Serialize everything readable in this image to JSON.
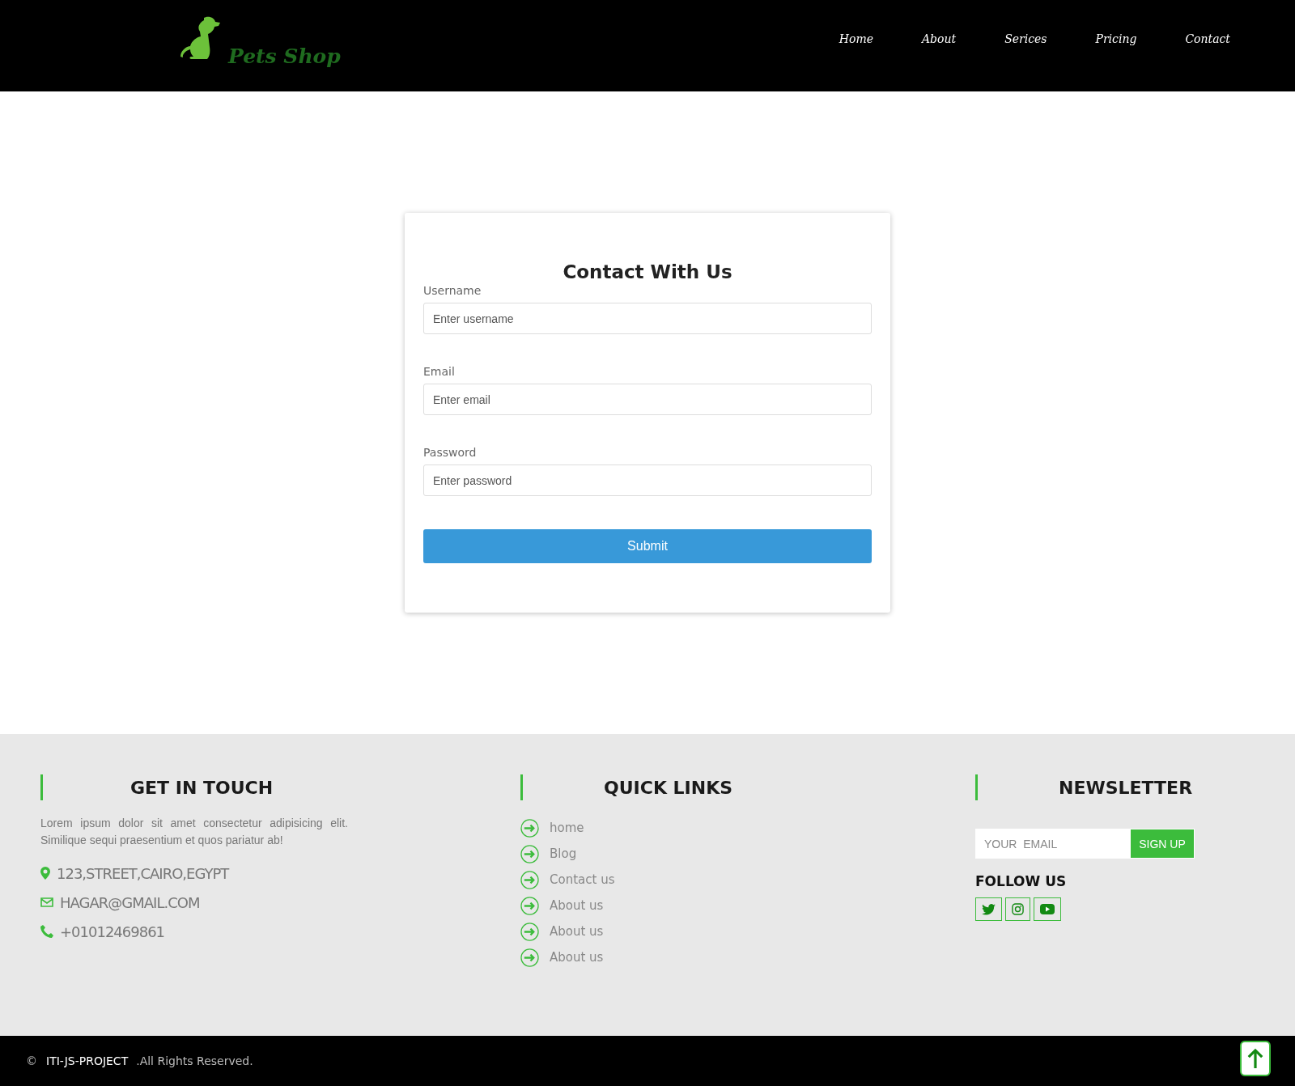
{
  "header": {
    "logo": "Pets Shop",
    "nav": [
      {
        "label": "Home"
      },
      {
        "label": "About"
      },
      {
        "label": "Serices"
      },
      {
        "label": "Pricing"
      },
      {
        "label": "Contact"
      }
    ]
  },
  "form": {
    "title": "Contact With Us",
    "fields": [
      {
        "label": "Username",
        "placeholder": "Enter username"
      },
      {
        "label": "Email",
        "placeholder": "Enter email"
      },
      {
        "label": "Password",
        "placeholder": "Enter password"
      }
    ],
    "submit": "Submit"
  },
  "footer": {
    "get_in_touch": {
      "title": "GET IN TOUCH",
      "text": "Lorem ipsum dolor sit amet consectetur adipisicing elit. Similique sequi praesentium et quos pariatur ab!",
      "contacts": [
        {
          "kind": "address",
          "text": "123,STREET,CAIRO,EGYPT"
        },
        {
          "kind": "email",
          "text": "HAGAR@GMAIL.COM"
        },
        {
          "kind": "phone",
          "text": "+01012469861"
        }
      ]
    },
    "quick_links": {
      "title": "QUICK LINKS",
      "links": [
        "home",
        "Blog",
        "Contact us",
        "About us",
        "About us",
        "About us"
      ]
    },
    "newsletter": {
      "title": "NEWSLETTER",
      "placeholder": "YOUR  EMAIL",
      "button": "SIGN  UP",
      "follow_title": "FOLLOW US",
      "socials": [
        {
          "kind": "twitter"
        },
        {
          "kind": "instagram"
        },
        {
          "kind": "youtube"
        }
      ]
    }
  },
  "bottom_bar": {
    "copyright": "©",
    "project": "ITI-JS-PROJECT",
    "rights": ".All Rights Reserved."
  }
}
